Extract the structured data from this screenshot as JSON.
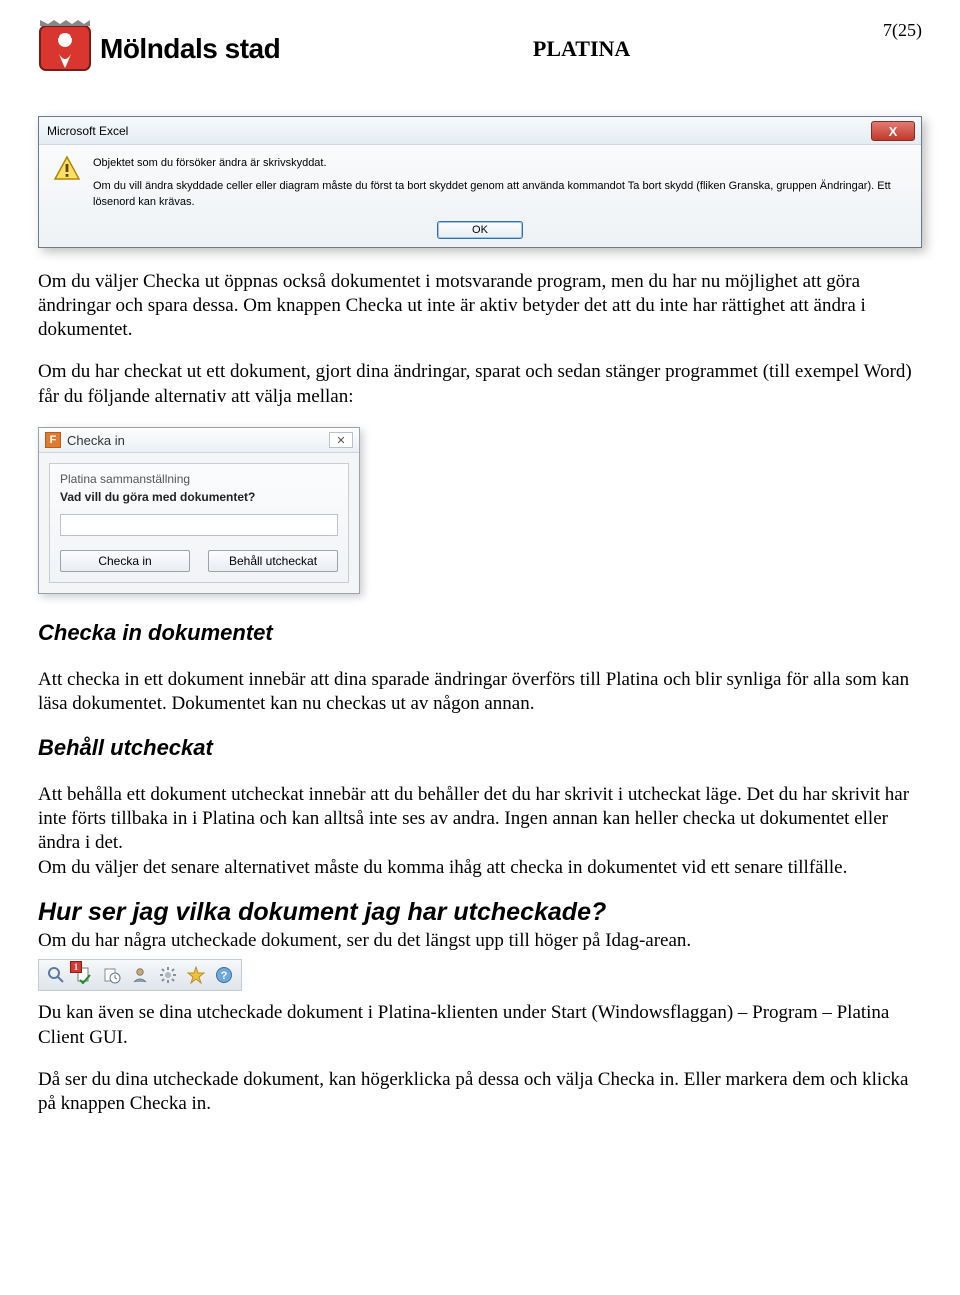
{
  "header": {
    "logo_text": "Mölndals stad",
    "title": "PLATINA",
    "page_number": "7(25)"
  },
  "excel_dialog": {
    "title": "Microsoft Excel",
    "close": "X",
    "msg1": "Objektet som du försöker ändra är skrivskyddat.",
    "msg2": "Om du vill ändra skyddade celler eller diagram måste du först ta bort skyddet genom att använda kommandot Ta bort skydd (fliken Granska, gruppen Ändringar). Ett lösenord kan krävas.",
    "ok": "OK"
  },
  "para1": "Om du väljer Checka ut öppnas också dokumentet i motsvarande program, men du har nu möjlighet att göra ändringar och spara dessa. Om knappen Checka ut inte är aktiv betyder det att du inte har rättighet att ändra i dokumentet.",
  "para2": "Om du har checkat ut ett dokument, gjort dina ändringar, sparat och sedan stänger programmet (till exempel Word) får du följande alternativ att välja mellan:",
  "checka_dialog": {
    "title": "Checka in",
    "sub": "Platina sammanställning",
    "question": "Vad vill du göra med dokumentet?",
    "btn_in": "Checka in",
    "btn_keep": "Behåll utcheckat",
    "close": "✕"
  },
  "section1": {
    "heading": "Checka in dokumentet",
    "text": "Att checka in ett dokument innebär att dina sparade ändringar överförs till Platina och blir synliga för alla som kan läsa dokumentet. Dokumentet kan nu checkas ut av någon annan."
  },
  "section2": {
    "heading": "Behåll utcheckat",
    "text": "Att behålla ett dokument utcheckat innebär att du behåller det du har skrivit i utcheckat läge. Det du har skrivit har inte förts tillbaka in i Platina och kan alltså inte ses av andra. Ingen annan kan heller checka ut dokumentet eller ändra i det.\nOm du väljer det senare alternativet måste du komma ihåg att checka in dokumentet vid ett senare tillfälle."
  },
  "section3": {
    "heading": "Hur ser jag vilka dokument jag har utcheckade?",
    "text1": "Om du har några utcheckade dokument, ser du det längst upp till höger på Idag-arean.",
    "badge": "1",
    "text2": "Du kan även se dina utcheckade dokument i Platina-klienten under Start (Windowsflaggan) – Program – Platina Client GUI.",
    "text3": "Då ser du dina utcheckade dokument, kan högerklicka på dessa och välja Checka in. Eller markera dem och klicka på knappen Checka in."
  },
  "icons": {
    "f": "F"
  }
}
